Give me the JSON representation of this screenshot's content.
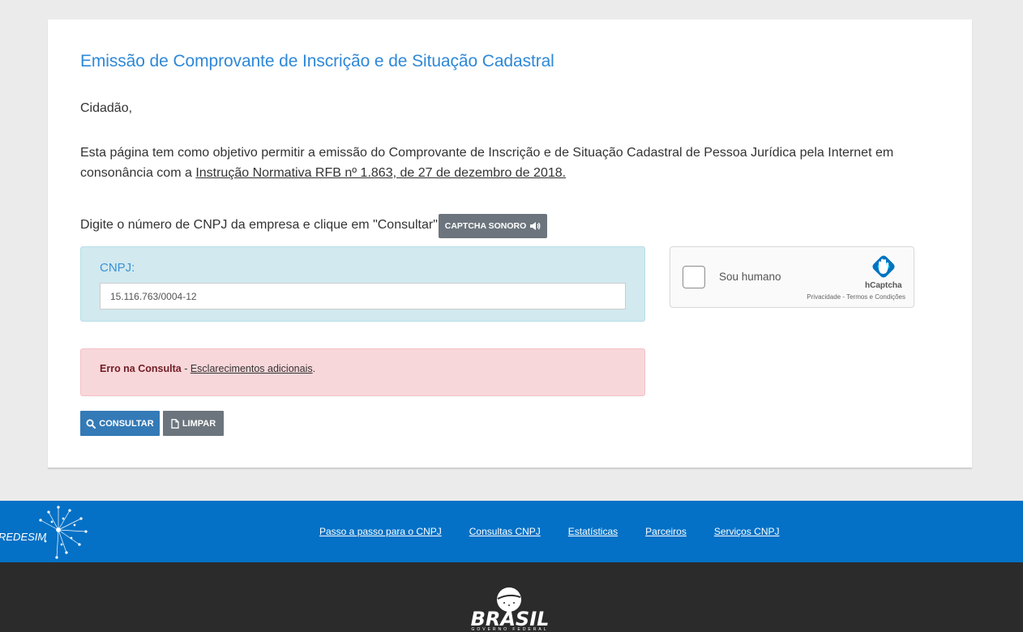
{
  "page": {
    "title": "Emissão de Comprovante de Inscrição e de Situação Cadastral",
    "greeting": "Cidadão,",
    "intro_text": "Esta página tem como objetivo permitir a emissão do Comprovante de Inscrição e de Situação Cadastral de Pessoa Jurídica pela Internet em consonância com a ",
    "intro_link": "Instrução Normativa RFB nº 1.863, de 27 de dezembro de 2018.",
    "instruction": "Digite o número de CNPJ da empresa e clique em \"Consultar\"."
  },
  "captcha_button": {
    "label": "CAPTCHA SONORO",
    "icon": "speaker-icon"
  },
  "cnpj_field": {
    "label": "CNPJ:",
    "value": "15.116.763/0004-12"
  },
  "hcaptcha": {
    "checkbox_label": "Sou humano",
    "brand": "hCaptcha",
    "privacy_link": "Privacidade",
    "separator": " - ",
    "terms_link": "Termos e Condições"
  },
  "alert": {
    "title": "Erro na Consulta",
    "separator": " - ",
    "link": "Esclarecimentos adicionais",
    "suffix": "."
  },
  "buttons": {
    "consultar": {
      "label": "CONSULTAR",
      "icon": "search-icon"
    },
    "limpar": {
      "label": "LIMPAR",
      "icon": "file-icon"
    }
  },
  "footer": {
    "nav": [
      "Passo a passo para o CNPJ",
      "Consultas CNPJ",
      "Estatísticas",
      "Parceiros",
      "Serviços CNPJ"
    ],
    "redesim_logo_text": "REDESIM",
    "brasil_logo_text": "BRASIL",
    "brasil_logo_sub": "GOVERNO FEDERAL"
  },
  "colors": {
    "title": "#2e88d8",
    "primary_button": "#337ab7",
    "secondary_button": "#6c757d",
    "alert_bg": "#f8d7da",
    "panel_bg": "#d1e9ef",
    "footer_blue": "#0471c6",
    "footer_dark": "#2b2b2b"
  }
}
